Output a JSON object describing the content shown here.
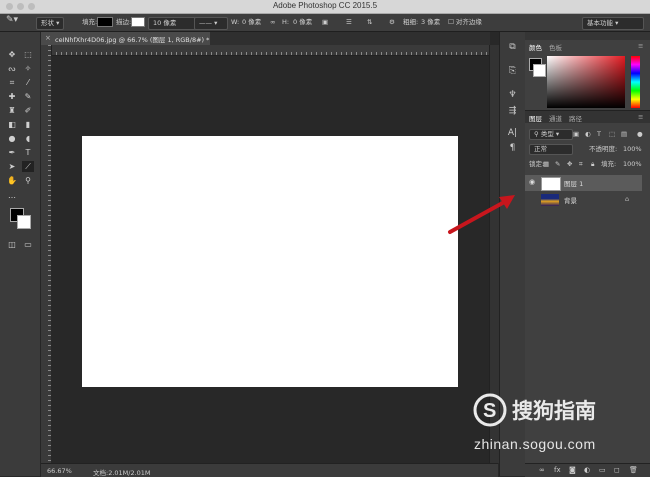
{
  "window": {
    "title": "Adobe Photoshop CC 2015.5"
  },
  "options_bar": {
    "shape_mode": "形状",
    "fill_label": "填充:",
    "stroke_label": "描边:",
    "stroke_width": "10 像素",
    "w_label": "W:",
    "w_value": "0 像素",
    "h_label": "H:",
    "h_value": "0 像素",
    "thickness_label": "粗细:",
    "thickness_value": "3 像素",
    "align_edges": "对齐边缘",
    "workspace": "基本功能"
  },
  "document": {
    "tab_label": "ceINhfXhr4D06.jpg @ 66.7% (图层 1, RGB/8#) *",
    "zoom_status": "66.67%",
    "doc_status": "文档:2.01M/2.01M"
  },
  "color_panel": {
    "tabs": [
      "颜色",
      "色板"
    ]
  },
  "layers_panel": {
    "tabs": [
      "图层",
      "通道",
      "路径"
    ],
    "filter_kind": "类型",
    "blend_mode": "正常",
    "opacity_label": "不透明度:",
    "opacity_value": "100%",
    "lock_label": "锁定:",
    "fill_label": "填充:",
    "fill_value": "100%",
    "layers": [
      {
        "name": "图层 1",
        "selected": true,
        "visible": true
      },
      {
        "name": "背景",
        "selected": false,
        "visible": false,
        "locked": true
      }
    ]
  },
  "annotation": {
    "arrow_color": "#c8161d"
  },
  "watermark": {
    "name": "搜狗指南",
    "url": "zhinan.sogou.com"
  }
}
